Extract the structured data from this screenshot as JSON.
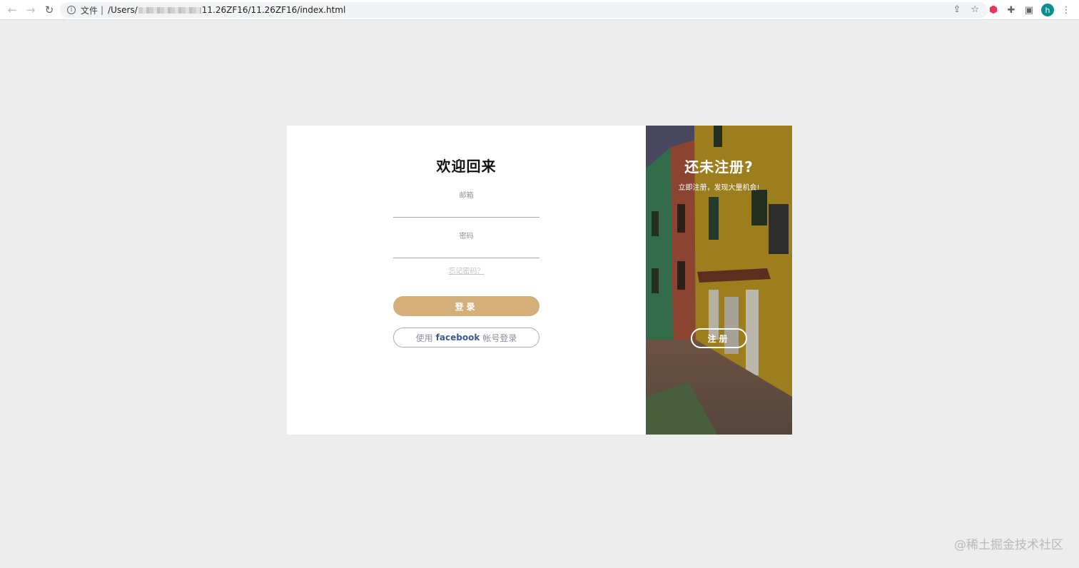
{
  "browser": {
    "back_icon": "←",
    "forward_icon": "→",
    "reload_icon": "↻",
    "info_icon": "i",
    "file_label": "文件",
    "separator": "|",
    "url_prefix": "/Users/",
    "url_suffix": "11.26ZF16/11.26ZF16/index.html",
    "share_icon": "⇪",
    "star_icon": "☆",
    "extension_icon": "⬢",
    "puzzle_icon": "✚",
    "sidepanel_icon": "▣",
    "avatar_letter": "h",
    "menu_icon": "⋮"
  },
  "login": {
    "title": "欢迎回来",
    "email_label": "邮箱",
    "password_label": "密码",
    "forgot_password": "忘记密码？",
    "login_button": "登录",
    "facebook_prefix": "使用",
    "facebook_brand": "facebook",
    "facebook_suffix": "帐号登录"
  },
  "signup": {
    "title": "还未注册?",
    "subtitle": "立即注册，发现大量机会!",
    "register_button": "注册"
  },
  "watermark": "@稀土掘金技术社区",
  "colors": {
    "page_bg": "#ededed",
    "accent": "#d4af7a",
    "facebook": "#3b5998"
  }
}
